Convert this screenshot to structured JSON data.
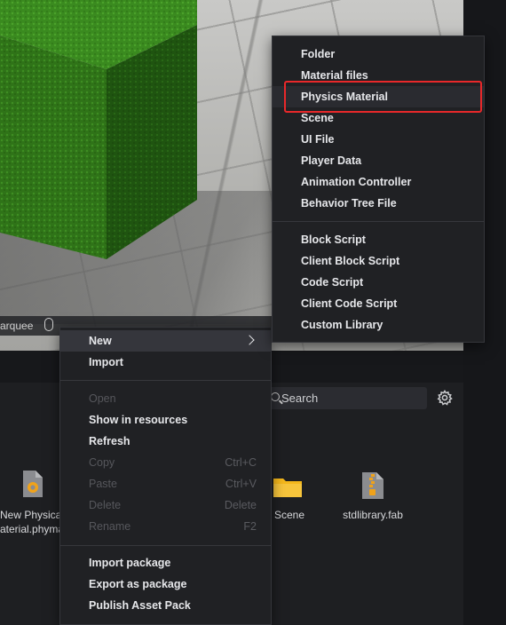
{
  "viewport": {
    "toolbar": {
      "marquee_label": "arquee"
    }
  },
  "asset_panel": {
    "search": {
      "placeholder": "Search"
    },
    "assets": [
      {
        "label_line1": "New Physical",
        "label_line2": "aterial.phyma",
        "icon": "physics-material-file-icon"
      },
      {
        "label_line1": "Scene",
        "label_line2": "",
        "icon": "folder-icon"
      },
      {
        "label_line1": "stdlibrary.fab",
        "label_line2": "",
        "icon": "zip-archive-icon"
      }
    ]
  },
  "context_menu": {
    "new": "New",
    "import": "Import",
    "open": "Open",
    "show_in_resources": "Show in resources",
    "refresh": "Refresh",
    "copy": "Copy",
    "copy_shortcut": "Ctrl+C",
    "paste": "Paste",
    "paste_shortcut": "Ctrl+V",
    "delete": "Delete",
    "delete_shortcut": "Delete",
    "rename": "Rename",
    "rename_shortcut": "F2",
    "import_package": "Import package",
    "export_as_package": "Export as package",
    "publish_asset_pack": "Publish Asset Pack"
  },
  "new_submenu": {
    "items_group1": [
      "Folder",
      "Material files",
      "Physics Material",
      "Scene",
      "UI File",
      "Player Data",
      "Animation Controller",
      "Behavior Tree File"
    ],
    "items_group2": [
      "Block Script",
      "Client Block Script",
      "Code Script",
      "Client Code Script",
      "Custom Library"
    ],
    "highlighted": "Physics Material"
  },
  "colors": {
    "highlight_border": "#e8282a",
    "cube_green": "#2f7318",
    "panel_bg": "#1e1f22",
    "folder_yellow": "#f5b81c",
    "asset_icon_orange": "#f0a21a"
  }
}
